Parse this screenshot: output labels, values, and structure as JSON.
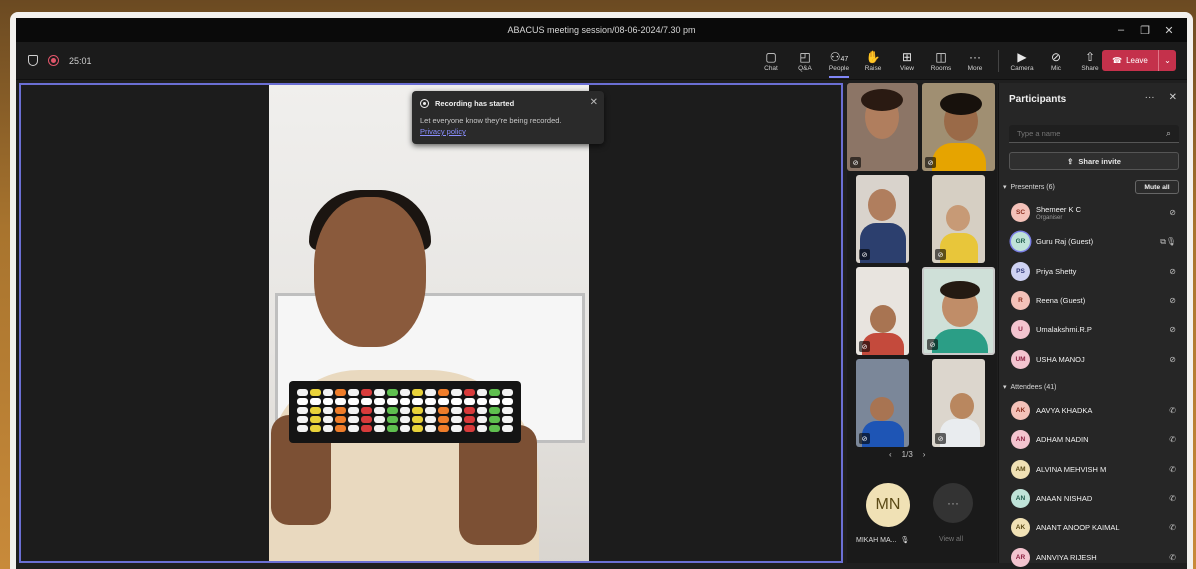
{
  "window": {
    "title": "ABACUS meeting session/08-06-2024/7.30 pm",
    "controls": [
      "–",
      "❐",
      "✕"
    ]
  },
  "toolbar": {
    "timer": "25:01",
    "tools": [
      {
        "label": "Chat",
        "icon": "chat-icon",
        "glyph": "💬"
      },
      {
        "label": "Q&A",
        "icon": "qa-icon",
        "glyph": "❓"
      },
      {
        "label": "People",
        "icon": "people-icon",
        "glyph": "👥",
        "count": "47",
        "active": true
      },
      {
        "label": "Raise",
        "icon": "raise-hand-icon",
        "glyph": "✋"
      },
      {
        "label": "View",
        "icon": "view-icon",
        "glyph": "▦"
      },
      {
        "label": "Rooms",
        "icon": "rooms-icon",
        "glyph": "◫"
      },
      {
        "label": "More",
        "icon": "more-icon",
        "glyph": "···"
      }
    ],
    "media": [
      {
        "label": "Camera",
        "icon": "camera-icon",
        "glyph": "📹"
      },
      {
        "label": "Mic",
        "icon": "mic-icon",
        "glyph": "🎙"
      },
      {
        "label": "Share",
        "icon": "share-icon",
        "glyph": "⬆"
      }
    ],
    "leave_label": "Leave"
  },
  "toast": {
    "title": "Recording has started",
    "body": "Let everyone know they're being recorded.",
    "link": "Privacy policy"
  },
  "gallery": {
    "pager": "1/3",
    "overflow_initials": "MN",
    "overflow_name": "MIKAH MA...",
    "view_all": "View all"
  },
  "participants": {
    "title": "Participants",
    "search_placeholder": "Type a name",
    "share_invite": "Share invite",
    "presenters_label": "Presenters (6)",
    "mute_all": "Mute all",
    "presenters": [
      {
        "initials": "SC",
        "name": "Shemeer K C",
        "role": "Organiser",
        "color": "#f4c2b9",
        "text": "#8a2c1d"
      },
      {
        "initials": "GR",
        "name": "Guru Raj (Guest)",
        "role": "",
        "color": "#bfe3d8",
        "text": "#1e5b4b",
        "speaking": true
      },
      {
        "initials": "PS",
        "name": "Priya Shetty",
        "role": "",
        "color": "#cfd3f3",
        "text": "#2e3678"
      },
      {
        "initials": "R",
        "name": "Reena (Guest)",
        "role": "",
        "color": "#f4c2b9",
        "text": "#8a2c1d"
      },
      {
        "initials": "U",
        "name": "Umalakshmi.R.P",
        "role": "",
        "color": "#f3c4cf",
        "text": "#8b2040"
      },
      {
        "initials": "UM",
        "name": "USHA MANOJ",
        "role": "",
        "color": "#f3c4cf",
        "text": "#8b2040"
      }
    ],
    "attendees_label": "Attendees (41)",
    "attendees": [
      {
        "initials": "AK",
        "name": "AAVYA KHADKA",
        "color": "#f4c2b9",
        "text": "#8a2c1d"
      },
      {
        "initials": "AN",
        "name": "ADHAM NADIN",
        "color": "#f3c4cf",
        "text": "#8b2040"
      },
      {
        "initials": "AM",
        "name": "ALVINA MEHVISH M",
        "color": "#f0e1b5",
        "text": "#5b4a16"
      },
      {
        "initials": "AN",
        "name": "ANAAN NISHAD",
        "color": "#bfe3d8",
        "text": "#1e5b4b"
      },
      {
        "initials": "AK",
        "name": "ANANT ANOOP KAIMAL",
        "color": "#f0e1b5",
        "text": "#5b4a16"
      },
      {
        "initials": "AR",
        "name": "ANNVIYA RIJESH",
        "color": "#f3c4cf",
        "text": "#8b2040"
      }
    ]
  },
  "colors": {
    "accent": "#7f85f5",
    "leave": "#c4314b",
    "stage_border": "#6b6fd4"
  }
}
